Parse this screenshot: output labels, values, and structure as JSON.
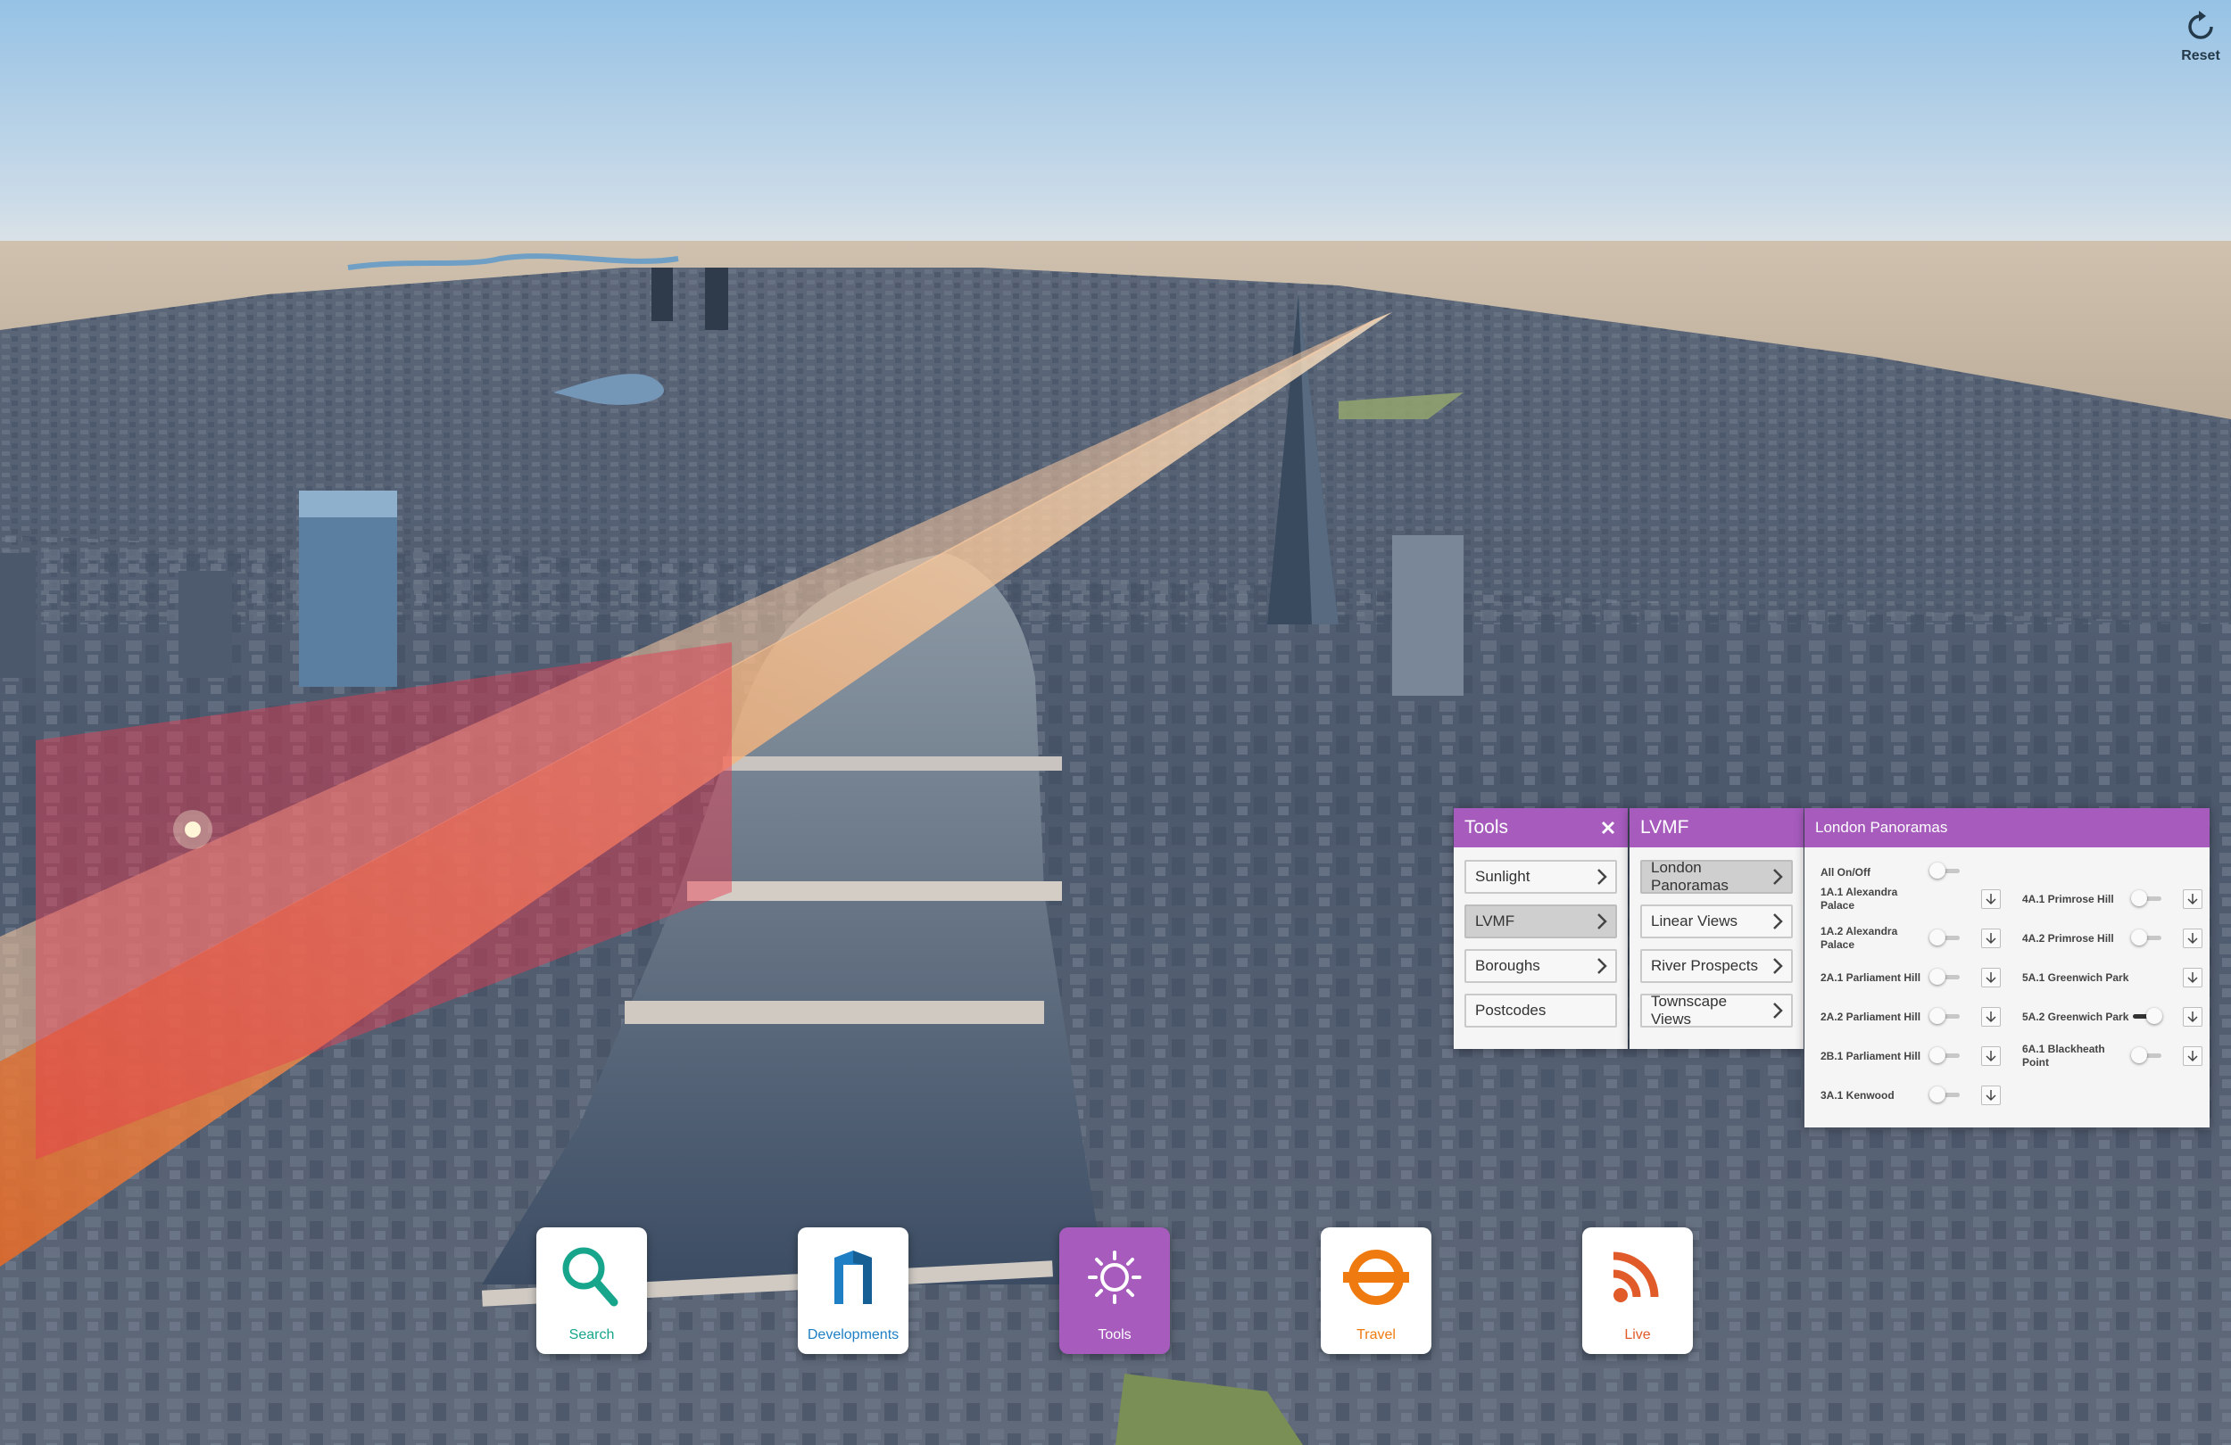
{
  "topbar": {
    "reset_label": "Reset",
    "reset_icon": "refresh-icon"
  },
  "tools_panel": {
    "title": "Tools",
    "close_icon": "close-icon",
    "items": [
      {
        "label": "Sunlight",
        "has_arrow": true,
        "active": false
      },
      {
        "label": "LVMF",
        "has_arrow": true,
        "active": true
      },
      {
        "label": "Boroughs",
        "has_arrow": true,
        "active": false
      },
      {
        "label": "Postcodes",
        "has_arrow": false,
        "active": false
      }
    ]
  },
  "lvmf_panel": {
    "title": "LVMF",
    "items": [
      {
        "label": "London Panoramas",
        "active": true
      },
      {
        "label": "Linear Views",
        "active": false
      },
      {
        "label": "River Prospects",
        "active": false
      },
      {
        "label": "Townscape Views",
        "active": false
      }
    ]
  },
  "panoramas_panel": {
    "title": "London Panoramas",
    "all_toggle": {
      "label": "All On/Off",
      "on": false
    },
    "left_column": [
      {
        "label": "1A.1 Alexandra Palace",
        "on": null
      },
      {
        "label": "1A.2 Alexandra Palace",
        "on": false
      },
      {
        "label": "2A.1 Parliament Hill",
        "on": false
      },
      {
        "label": "2A.2 Parliament Hill",
        "on": false
      },
      {
        "label": "2B.1 Parliament Hill",
        "on": false
      },
      {
        "label": "3A.1 Kenwood",
        "on": false
      }
    ],
    "right_column": [
      {
        "label": "4A.1 Primrose Hill",
        "on": false
      },
      {
        "label": "4A.2 Primrose Hill",
        "on": false
      },
      {
        "label": "5A.1 Greenwich Park",
        "on": null
      },
      {
        "label": "5A.2 Greenwich Park",
        "on": true
      },
      {
        "label": "6A.1 Blackheath Point",
        "on": false
      }
    ]
  },
  "dock": [
    {
      "label": "Search",
      "icon": "search-icon",
      "color": "#17a58c",
      "active": false
    },
    {
      "label": "Developments",
      "icon": "building-icon",
      "color": "#1f7fc4",
      "active": false
    },
    {
      "label": "Tools",
      "icon": "sun-icon",
      "color": "#ffffff",
      "active": true
    },
    {
      "label": "Travel",
      "icon": "roundel-icon",
      "color": "#ef7b10",
      "active": false
    },
    {
      "label": "Live",
      "icon": "rss-icon",
      "color": "#e05a2a",
      "active": false
    }
  ],
  "colors": {
    "accent": "#a65bbd",
    "sky_top": "#98c3e4",
    "sky_horizon": "#dde6ee",
    "view_corridor": "#f4a35f"
  }
}
